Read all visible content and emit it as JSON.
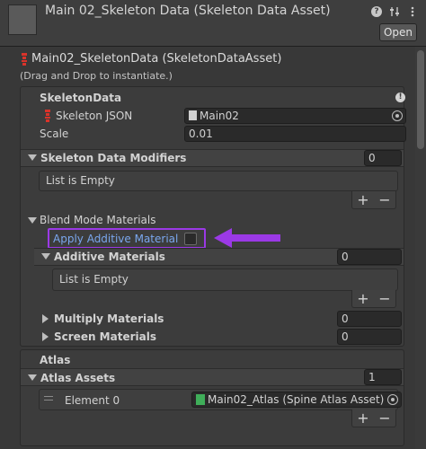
{
  "header": {
    "title": "Main 02_Skeleton Data (Skeleton Data Asset)",
    "open_label": "Open",
    "icons": [
      "help-icon",
      "preset-sliders-icon",
      "more-options-icon"
    ]
  },
  "asset": {
    "title": "Main02_SkeletonData (SkeletonDataAsset)",
    "drag_hint": "(Drag and Drop to instantiate.)"
  },
  "skeleton_data": {
    "heading": "SkeletonData",
    "json_label": "Skeleton JSON",
    "json_value": "Main02",
    "scale_label": "Scale",
    "scale_value": "0.01"
  },
  "modifiers": {
    "label": "Skeleton Data Modifiers",
    "count": "0",
    "empty": "List is Empty"
  },
  "blend": {
    "heading": "Blend Mode Materials",
    "apply_additive_label": "Apply Additive Material",
    "apply_additive_checked": false,
    "additive_label": "Additive Materials",
    "additive_count": "0",
    "additive_empty": "List is Empty",
    "multiply_label": "Multiply Materials",
    "multiply_count": "0",
    "screen_label": "Screen Materials",
    "screen_count": "0"
  },
  "atlas": {
    "heading": "Atlas",
    "assets_label": "Atlas Assets",
    "assets_count": "1",
    "element_label": "Element 0",
    "element_value": "Main02_Atlas (Spine Atlas Asset)"
  },
  "list_controls": {
    "plus": "+",
    "minus": "−"
  },
  "colors": {
    "highlight": "#9b39e6",
    "atlas_icon": "#3fae59",
    "spine_icon": "#d9332a"
  }
}
